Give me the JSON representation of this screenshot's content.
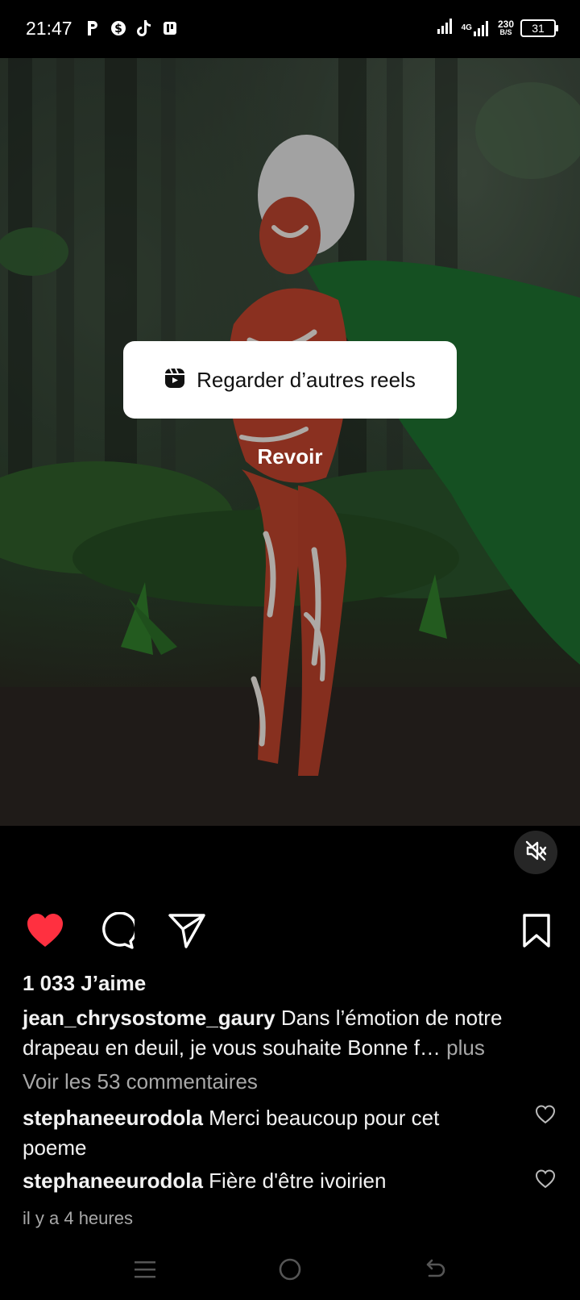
{
  "status_bar": {
    "time": "21:47",
    "left_icons": [
      "p-icon",
      "dollar-icon",
      "tiktok-icon",
      "payment-icon"
    ],
    "network_type": "4G",
    "speed_value": "230",
    "speed_unit": "B/S",
    "battery": "31"
  },
  "media": {
    "overlay_button_label": "Regarder d’autres reels",
    "replay_label": "Revoir",
    "mute_icon": "speaker-muted-icon"
  },
  "actions": {
    "like_icon": "heart-filled-icon",
    "comment_icon": "comment-icon",
    "share_icon": "send-icon",
    "save_icon": "bookmark-icon",
    "like_color": "#ff3040"
  },
  "post": {
    "likes": "1 033 J’aime",
    "author": "jean_chrysostome_gaury",
    "caption_line1": " Dans l’émotion de notre",
    "caption_line2": "drapeau en deuil, je vous souhaite Bonne f…",
    "more_label": " plus",
    "view_comments": "Voir les 53 commentaires",
    "comments": [
      {
        "user": "stephaneeurodola",
        "text_line1": " Merci beaucoup pour cet",
        "text_line2": "poeme"
      },
      {
        "user": "stephaneeurodola",
        "text_line1": " Fière d'être ivoirien"
      }
    ],
    "timestamp": "il y a 4 heures"
  },
  "nav": {
    "items": [
      "menu-icon",
      "home-icon",
      "back-icon"
    ]
  }
}
